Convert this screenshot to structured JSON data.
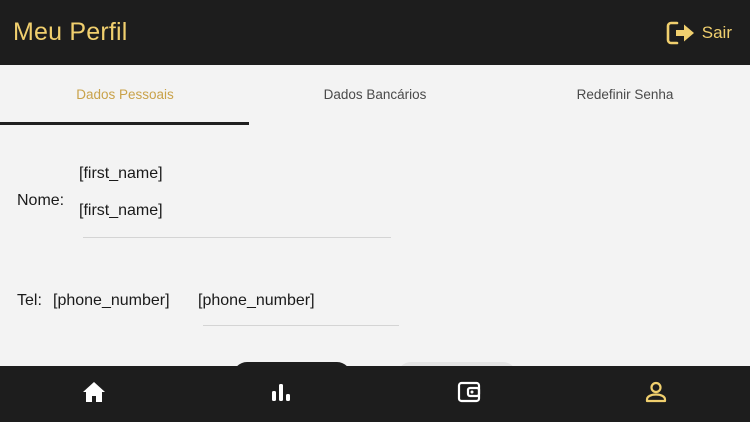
{
  "header": {
    "title": "Meu Perfil",
    "logout_label": "Sair",
    "logout_icon": "logout-icon"
  },
  "tabs": [
    {
      "label": "Dados Pessoais",
      "active": true
    },
    {
      "label": "Dados Bancários",
      "active": false
    },
    {
      "label": "Redefinir Senha",
      "active": false
    }
  ],
  "form": {
    "name_label": "Nome:",
    "first_name_display": "[first_name]",
    "first_name_input": "[first_name]",
    "phone_label": "Tel:",
    "phone_display": "[phone_number]",
    "phone_input": "[phone_number]"
  },
  "bottom_nav": [
    {
      "icon": "home-icon",
      "active": false
    },
    {
      "icon": "bar-chart-icon",
      "active": false
    },
    {
      "icon": "wallet-icon",
      "active": false
    },
    {
      "icon": "user-icon",
      "active": true
    }
  ],
  "colors": {
    "accent": "#f0cf6e",
    "tab_active": "#c9a24a",
    "dark_bg": "#1d1d1d",
    "nav_icon": "#ffffff"
  }
}
